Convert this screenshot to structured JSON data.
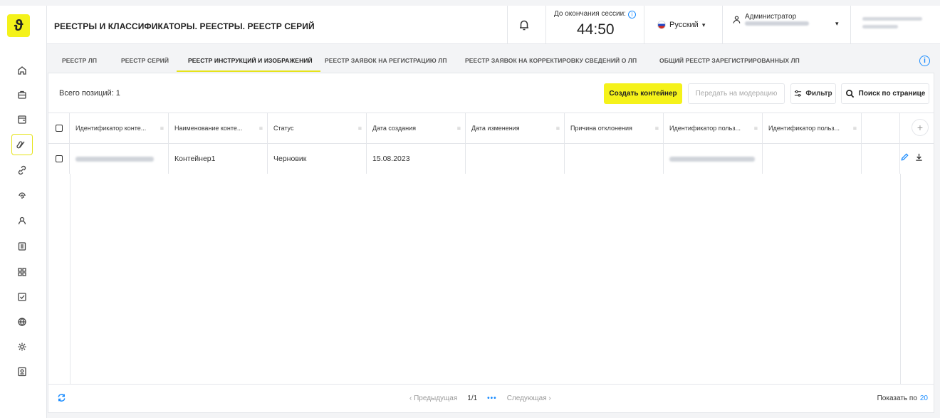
{
  "logo": {
    "glyph": "ϑ"
  },
  "header": {
    "title": "РЕЕСТРЫ И КЛАССИФИКАТОРЫ. РЕЕСТРЫ. РЕЕСТР СЕРИЙ",
    "session_label": "До окончания сессии:",
    "session_time": "44:50",
    "language": "Русский",
    "user_role": "Администратор"
  },
  "tabs": [
    {
      "label": "РЕЕСТР ЛП"
    },
    {
      "label": "РЕЕСТР СЕРИЙ"
    },
    {
      "label": "РЕЕСТР ИНСТРУКЦИЙ И ИЗОБРАЖЕНИЙ",
      "active": true
    },
    {
      "label": "РЕЕСТР ЗАЯВОК НА РЕГИСТРАЦИЮ ЛП"
    },
    {
      "label": "РЕЕСТР ЗАЯВОК НА КОРРЕКТИРОВКУ СВЕДЕНИЙ О ЛП"
    },
    {
      "label": "ОБЩИЙ РЕЕСТР ЗАРЕГИСТРИРОВАННЫХ ЛП"
    }
  ],
  "toolbar": {
    "total": "Всего позиций: 1",
    "create": "Создать контейнер",
    "moderate": "Передать на модерацию",
    "filter": "Фильтр",
    "search": "Поиск по странице"
  },
  "table": {
    "columns": [
      "Идентификатор конте...",
      "Наименование конте...",
      "Статус",
      "Дата создания",
      "Дата изменения",
      "Причина отклонения",
      "Идентификатор польз...",
      "Идентификатор польз..."
    ],
    "rows": [
      {
        "name": "Контейнер1",
        "status": "Черновик",
        "created": "15.08.2023",
        "modified": "",
        "reason": ""
      }
    ]
  },
  "footer": {
    "prev": "Предыдущая",
    "page": "1/1",
    "dots": "•••",
    "next": "Следующая",
    "page_size_label": "Показать по",
    "page_size": "20"
  },
  "colors": {
    "accent": "#f5f21a",
    "link": "#1a8cff"
  }
}
